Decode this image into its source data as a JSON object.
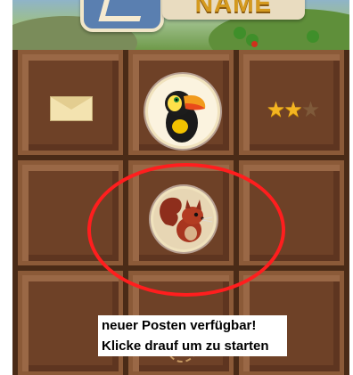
{
  "banner": {
    "title_text": "NAME"
  },
  "tiles": {
    "mail": {
      "icon": "envelope-icon"
    },
    "toucan": {
      "icon": "toucan-icon"
    },
    "rating": {
      "stars_filled": 2,
      "stars_total": 3,
      "icon": "star-icon"
    },
    "squirrel": {
      "icon": "squirrel-icon"
    }
  },
  "tooltip": {
    "line1": "neuer Posten verfügbar!",
    "line2": "Klicke drauf um zu starten"
  },
  "colors": {
    "highlight_ring": "#ff1e1e",
    "chocolate": "#7a4a2c",
    "star": "#f4b521"
  }
}
